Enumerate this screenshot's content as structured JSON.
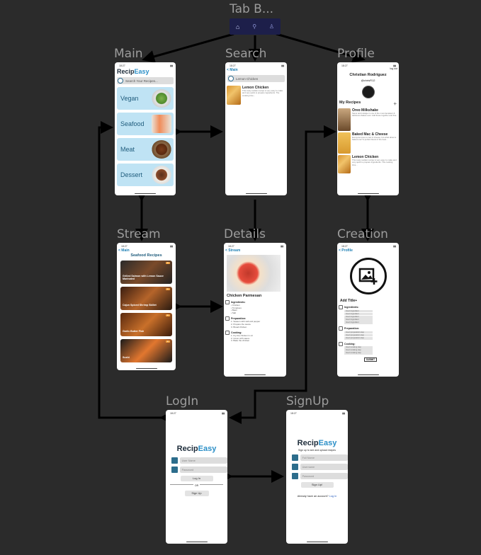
{
  "flow_labels": {
    "tabbar": "Tab B...",
    "main": "Main",
    "search": "Search",
    "profile": "Profile",
    "stream": "Stream",
    "details": "Details",
    "creation": "Creation",
    "login": "LogIn",
    "signup": "SignUp"
  },
  "status_time": "18:27",
  "main": {
    "brand_a": "Recip",
    "brand_b": "Easy",
    "search_placeholder": "Search Your Recipes...",
    "categories": [
      "Vegan",
      "Seafood",
      "Meat",
      "Dessert"
    ]
  },
  "search": {
    "back": "< Main",
    "query": "Lemon Chicken",
    "result_title": "Lemon Chicken",
    "result_desc": "This zesty sudden recipe is very easy to make and very quick to prepare ingredients. The cooking time..."
  },
  "profile": {
    "logout": "log out",
    "name": "Christian Rodriguez",
    "handle": "@chrisR12",
    "my_recipes": "My Recipes",
    "add": "+",
    "recipes": [
      {
        "title": "Oreo Milkshake",
        "desc": "Savor and indulge in one of the most decadent & delicious shakes ever. Add these together and fine..."
      },
      {
        "title": "Baked Mac & Cheese",
        "desc": "Everyone loves a mac & cheese, but what about a baked one? A perfect blend of the heat..."
      },
      {
        "title": "Lemon Chicken",
        "desc": "This zesty sudden recipe is very easy to make and very quick to prepare ingredients. The cooking time..."
      }
    ]
  },
  "stream": {
    "back": "< Main",
    "title": "Seafood Recipes",
    "cards": [
      {
        "title": "Grilled Salmon with Lemon Sauce Marinated"
      },
      {
        "title": "Cajun Spiced Shrimp Skillet"
      },
      {
        "title": "Garlic Butter Fish"
      },
      {
        "title": "Sushi"
      }
    ]
  },
  "details": {
    "back": "< Stream",
    "title": "Chicken Parmesan",
    "ingredients_h": "Ingredients:",
    "ingredients": [
      "Chicken",
      "Tomatoes",
      "Basil",
      "Salt"
    ],
    "preparation_h": "Preparation:",
    "preparation": [
      "Season with salt and pepper",
      "Prepare the sauce",
      "Bread chicken"
    ],
    "cooking_h": "Cooking:",
    "cooking": [
      "Fry the chicken in oil",
      "Cover with sauce",
      "Bake the chicken"
    ]
  },
  "creation": {
    "back": "< Profile",
    "add_title": "Add Title+",
    "ingredients_h": "Ingredients:",
    "ingredient_lines": [
      "Insert ingredient",
      "Insert ingredient",
      "Insert ingredient",
      "Insert ingredient",
      "Insert ingredient"
    ],
    "preparation_h": "Preparation:",
    "prep_lines": [
      "Insert preparation step",
      "Insert preparation step",
      "Insert preparation step"
    ],
    "cooking_h": "Cooking:",
    "cook_lines": [
      "Insert cooking step",
      "Insert cooking step",
      "Insert cooking step"
    ],
    "submit": "SUBMIT"
  },
  "login": {
    "brand_a": "Recip",
    "brand_b": "Easy",
    "username": "User Name",
    "password": "Password",
    "login_btn": "Log In",
    "or": "OR",
    "signup_btn": "Sign Up"
  },
  "signup": {
    "brand_a": "Recip",
    "brand_b": "Easy",
    "subtitle": "Sign up to see and upload recipes",
    "fullname": "Full Name",
    "username": "Username",
    "password": "Password",
    "signup_btn": "Sign Up!",
    "already": "Already have an account?",
    "login_link": "Log In"
  },
  "colors": {
    "background": "#2b2b2b",
    "accent": "#2b8fc7",
    "category_bg": "#bfe3f4",
    "arrow": "#000000"
  }
}
